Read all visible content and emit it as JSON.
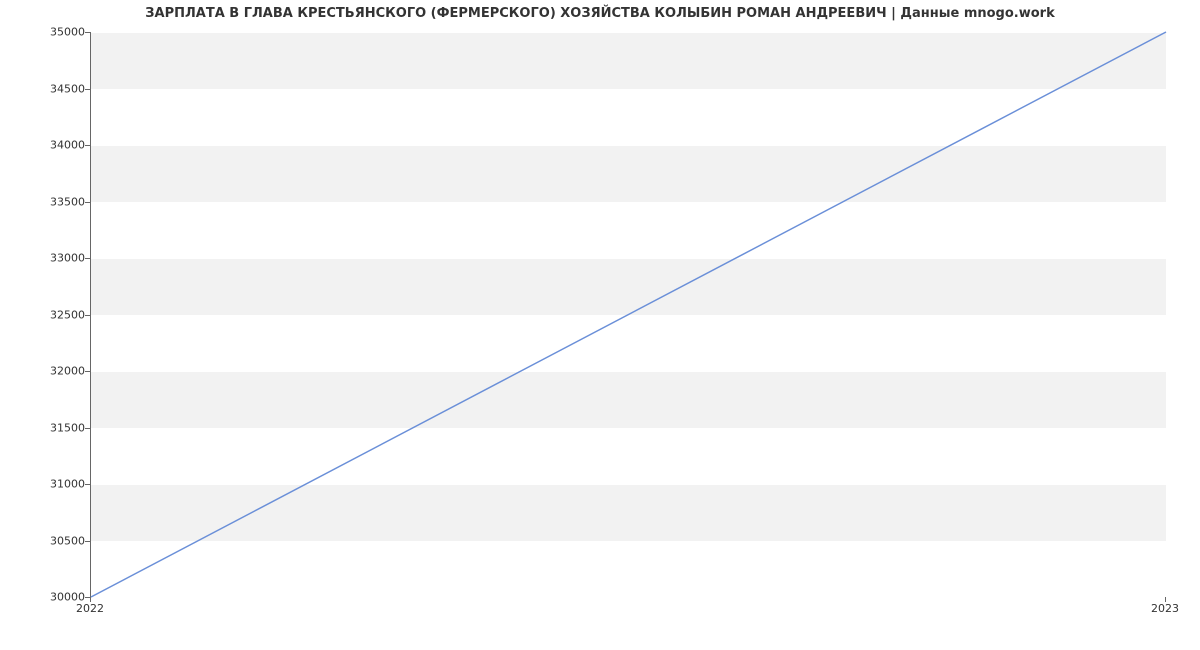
{
  "chart_data": {
    "type": "line",
    "title": "ЗАРПЛАТА В ГЛАВА КРЕСТЬЯНСКОГО (ФЕРМЕРСКОГО) ХОЗЯЙСТВА КОЛЫБИН РОМАН АНДРЕЕВИЧ | Данные mnogo.work",
    "x": [
      2022,
      2023
    ],
    "values": [
      30000,
      35000
    ],
    "x_tick_labels": [
      "2022",
      "2023"
    ],
    "y_ticks": [
      30000,
      30500,
      31000,
      31500,
      32000,
      32500,
      33000,
      33500,
      34000,
      34500,
      35000
    ],
    "y_tick_labels": [
      "30000",
      "30500",
      "31000",
      "31500",
      "32000",
      "32500",
      "33000",
      "33500",
      "34000",
      "34500",
      "35000"
    ],
    "xlim": [
      2022,
      2023
    ],
    "ylim": [
      30000,
      35000
    ],
    "line_color": "#6a8fd8",
    "xlabel": "",
    "ylabel": ""
  }
}
